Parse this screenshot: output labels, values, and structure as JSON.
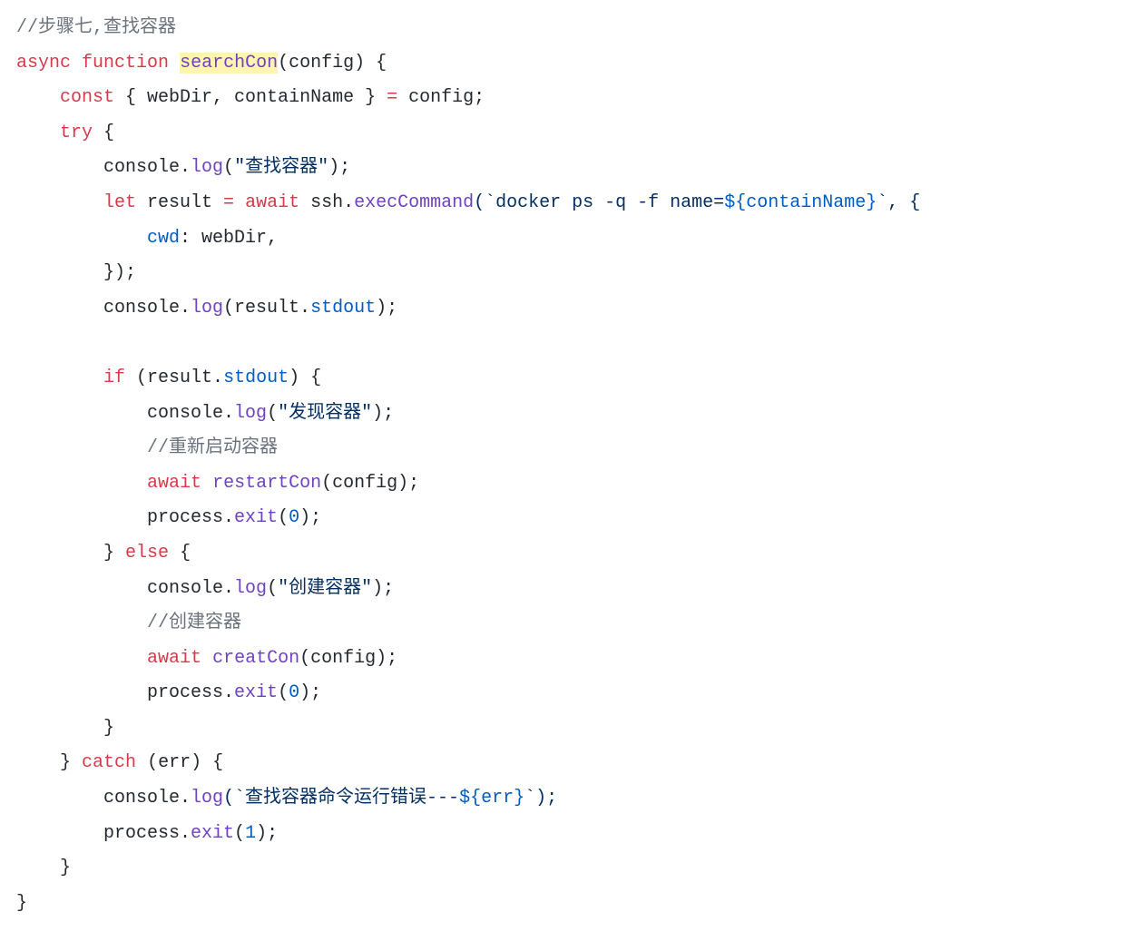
{
  "code": {
    "comment_header": "//步骤七,查找容器",
    "kw_async": "async",
    "kw_function": "function",
    "fn_name": "searchCon",
    "sig_open": "(config) {",
    "kw_const": "const",
    "destruct": " { webDir, containName } ",
    "eq": "=",
    "config_semi": " config;",
    "kw_try": "try",
    "brace_open": " {",
    "console": "console.",
    "fn_log": "log",
    "str_search": "\"查找容器\"",
    "paren_close_semi": ");",
    "kw_let": "let",
    "result_eq": " result ",
    "kw_await": "await",
    "ssh": " ssh.",
    "fn_exec": "execCommand",
    "tpl_docker_open": "(`docker ps -q -f name=",
    "tpl_interp": "${containName}",
    "tpl_docker_close": "`, {",
    "cwd_key": "cwd",
    "cwd_val": ": webDir,",
    "obj_close": "});",
    "log_result_open": "(result.",
    "stdout": "stdout",
    "kw_if": "if",
    "if_cond_open": " (result.",
    "if_cond_close": ") {",
    "str_found": "\"发现容器\"",
    "comment_restart": "//重新启动容器",
    "fn_restart": "restartCon",
    "call_config": "(config);",
    "process": "process.",
    "fn_exit": "exit",
    "exit0_open": "(",
    "num0": "0",
    "exit_close": ");",
    "brace_close": "}",
    "kw_else": "else",
    "str_create": "\"创建容器\"",
    "comment_create": "//创建容器",
    "fn_create": "creatCon",
    "kw_catch": "catch",
    "catch_sig": " (err) {",
    "tpl_err_open": "(`查找容器命令运行错误---",
    "tpl_err_interp": "${err}",
    "tpl_err_close": "`);",
    "num1": "1"
  }
}
